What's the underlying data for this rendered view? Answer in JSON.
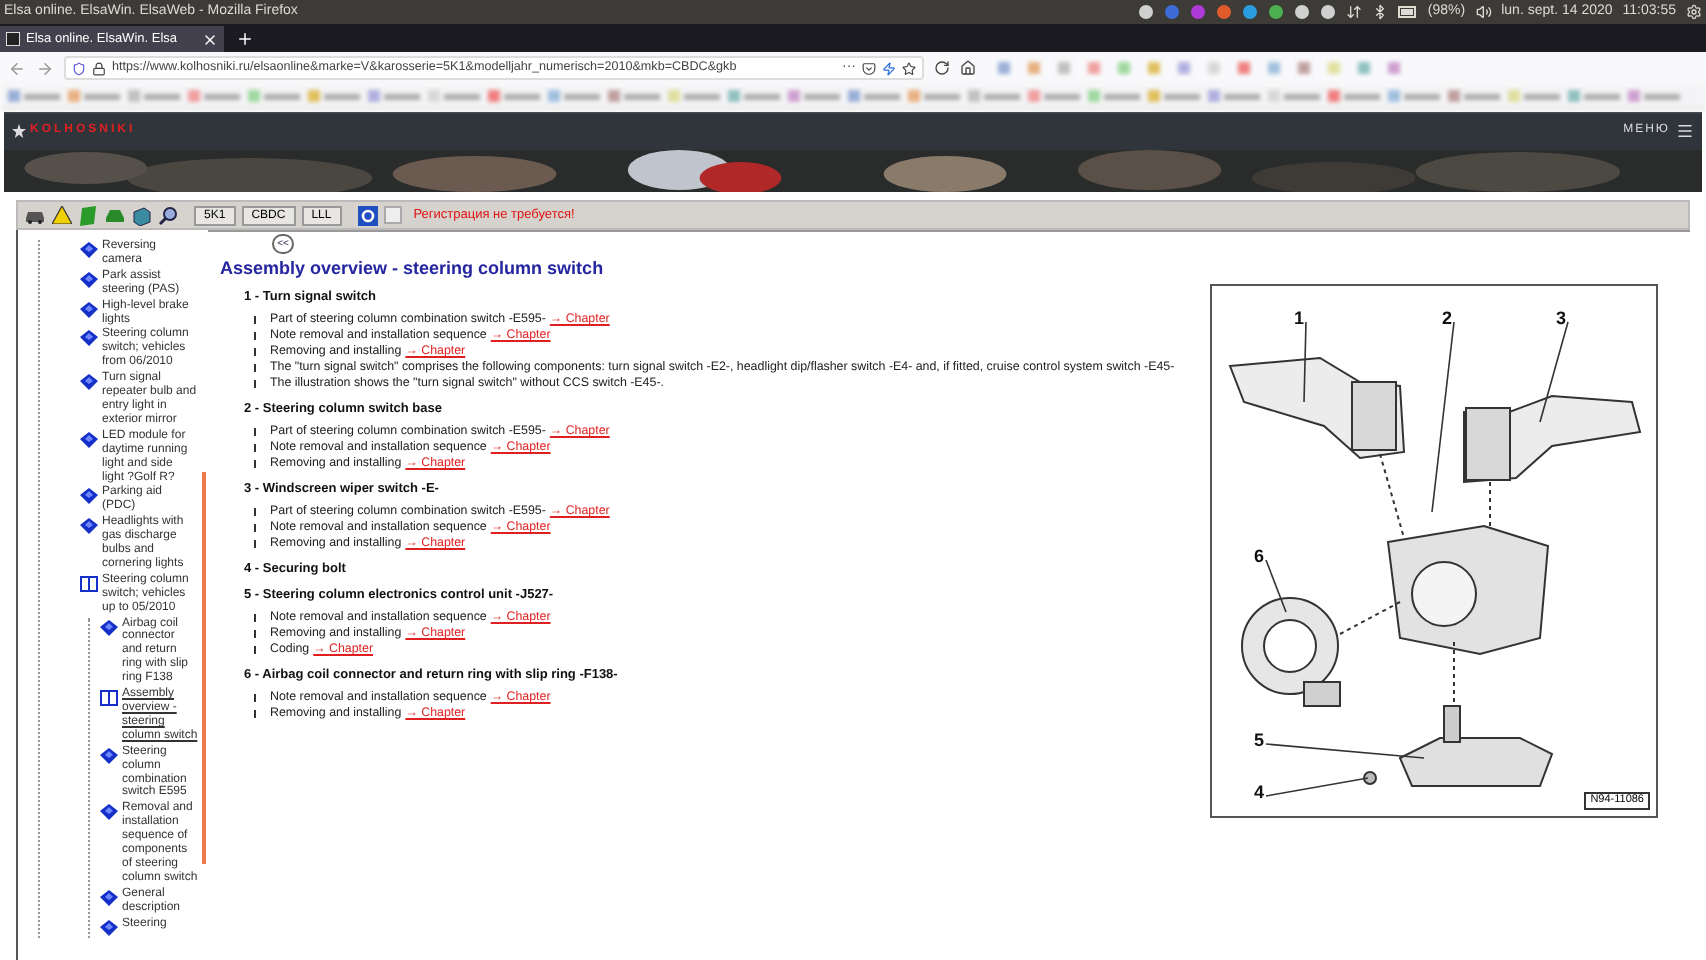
{
  "os_panel": {
    "title": "Elsa online. ElsaWin. ElsaWeb - Mozilla Firefox",
    "battery": "(98%)",
    "date": "lun. sept. 14 2020",
    "time": "11:03:55"
  },
  "browser": {
    "tabs": [
      {
        "label": "Elsa online. ElsaWin. Elsa",
        "selected": true
      }
    ],
    "url": "https://www.kolhosniki.ru/elsaonline&marke=V&karosserie=5K1&modelljahr_numerisch=2010&mkb=CBDC&gkb",
    "more": "···"
  },
  "site": {
    "logo": "KOLHOSNIKI",
    "menu": "МЕНЮ"
  },
  "toolbar": {
    "buttons": [
      "5K1",
      "CBDC",
      "LLL"
    ],
    "notice": "Регистрация не требуется!"
  },
  "sidebar": {
    "items": [
      {
        "label": "Reversing camera",
        "kind": "page",
        "selected": false
      },
      {
        "label": "Park assist steering (PAS)",
        "kind": "page",
        "selected": false
      },
      {
        "label": "High-level brake lights",
        "kind": "page",
        "selected": false
      },
      {
        "label": "Steering column switch; vehicles from 06/2010",
        "kind": "page",
        "selected": false
      },
      {
        "label": "Turn signal repeater bulb and entry light in exterior mirror",
        "kind": "page",
        "selected": false
      },
      {
        "label": "LED module for daytime running light and side light ?Golf R?",
        "kind": "page",
        "selected": false
      },
      {
        "label": "Parking aid (PDC)",
        "kind": "page",
        "selected": false
      },
      {
        "label": "Headlights with gas discharge bulbs and cornering lights",
        "kind": "page",
        "selected": false
      },
      {
        "label": "Steering column switch; vehicles up to 05/2010",
        "kind": "book",
        "selected": false,
        "children": [
          {
            "label": "Airbag coil connector and return ring with slip ring F138",
            "kind": "page",
            "selected": false
          },
          {
            "label": "Assembly overview - steering column switch",
            "kind": "book",
            "selected": true
          },
          {
            "label": "Steering column combination switch E595",
            "kind": "page",
            "selected": false
          },
          {
            "label": "Removal and installation sequence of components of steering column switch",
            "kind": "page",
            "selected": false
          },
          {
            "label": "General description",
            "kind": "page",
            "selected": false
          },
          {
            "label": "Steering",
            "kind": "page",
            "selected": false
          }
        ]
      }
    ]
  },
  "content": {
    "back": "<<",
    "title": "Assembly overview - steering column switch",
    "sections": [
      {
        "heading": "1 - Turn signal switch",
        "bullets": [
          {
            "text": "Part of steering column combination switch -E595-",
            "link": "→ Chapter"
          },
          {
            "text": "Note removal and installation sequence",
            "link": "→ Chapter"
          },
          {
            "text": "Removing and installing",
            "link": "→ Chapter"
          },
          {
            "text": "The \"turn signal switch\" comprises the following components: turn signal switch -E2-, headlight dip/flasher switch -E4- and, if fitted, cruise control system switch -E45-"
          },
          {
            "text": "The illustration shows the \"turn signal switch\" without CCS switch -E45-."
          }
        ]
      },
      {
        "heading": "2 - Steering column switch base",
        "bullets": [
          {
            "text": "Part of steering column combination switch -E595-",
            "link": "→ Chapter"
          },
          {
            "text": "Note removal and installation sequence",
            "link": "→ Chapter"
          },
          {
            "text": "Removing and installing",
            "link": "→ Chapter"
          }
        ]
      },
      {
        "heading": "3 - Windscreen wiper switch -E-",
        "bullets": [
          {
            "text": "Part of steering column combination switch -E595-",
            "link": "→ Chapter"
          },
          {
            "text": "Note removal and installation sequence",
            "link": "→ Chapter"
          },
          {
            "text": "Removing and installing",
            "link": "→ Chapter"
          }
        ]
      },
      {
        "heading": "4 - Securing bolt"
      },
      {
        "heading": "5 - Steering column electronics control unit -J527-",
        "bullets": [
          {
            "text": "Note removal and installation sequence",
            "link": "→ Chapter"
          },
          {
            "text": "Removing and installing",
            "link": "→ Chapter"
          },
          {
            "text": "Coding",
            "link": "→ Chapter"
          }
        ]
      },
      {
        "heading": "6 - Airbag coil connector and return ring with slip ring -F138-",
        "bullets": [
          {
            "text": "Note removal and installation sequence",
            "link": "→ Chapter"
          },
          {
            "text": "Removing and installing",
            "link": "→ Chapter"
          }
        ]
      }
    ]
  },
  "figure": {
    "callouts": [
      "1",
      "2",
      "3",
      "6",
      "5",
      "4"
    ],
    "code": "N94-11086"
  }
}
